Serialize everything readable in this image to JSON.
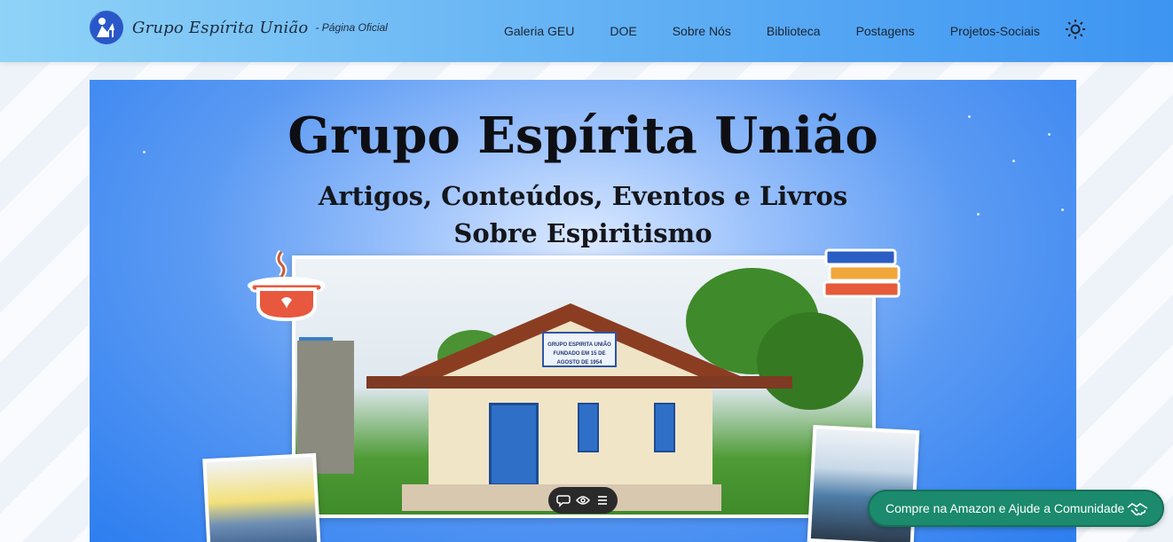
{
  "header": {
    "logo_title": "Grupo Espírita União",
    "logo_subtitle": "- Página Oficial",
    "nav": [
      {
        "label": "Galeria GEU"
      },
      {
        "label": "DOE"
      },
      {
        "label": "Sobre Nós"
      },
      {
        "label": "Biblioteca"
      },
      {
        "label": "Postagens"
      },
      {
        "label": "Projetos-Sociais"
      }
    ],
    "theme_icon": "sun-icon"
  },
  "hero": {
    "title": "Grupo Espírita União",
    "subtitle_line1": "Artigos, Conteúdos, Eventos e Livros",
    "subtitle_line2": "Sobre Espiritismo",
    "sign_line1": "GRUPO ESPIRITA UNIÃO",
    "sign_line2": "FUNDADO EM 15 DE AGOSTO DE 1954"
  },
  "floating_toolbar": {
    "icons": [
      "comment-icon",
      "eye-icon",
      "menu-icon"
    ]
  },
  "cta": {
    "label": "Compre na Amazon e Ajude a Comunidade",
    "icon": "handshake-icon"
  },
  "colors": {
    "header_gradient_start": "#8fd3f7",
    "header_gradient_end": "#3d95f2",
    "cta_bg": "#1b8a6d",
    "hero_bg": "#5b9af3"
  }
}
